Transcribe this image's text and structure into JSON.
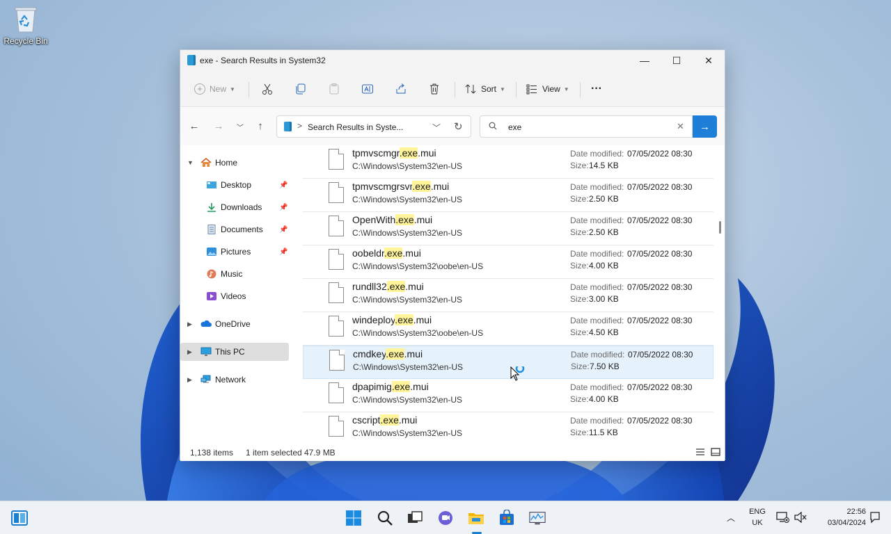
{
  "desktop": {
    "recycle_bin_label": "Recycle Bin"
  },
  "window": {
    "title": "exe - Search Results in System32",
    "controls": {
      "minimize": "—",
      "maximize": "☐",
      "close": "✕"
    }
  },
  "toolbar": {
    "new_label": "New",
    "sort_label": "Sort",
    "view_label": "View",
    "more_label": "···"
  },
  "address": {
    "separator": ">",
    "path": "Search Results in Syste...",
    "search_value": "exe"
  },
  "sidebar": {
    "items": [
      {
        "label": "Home",
        "icon": "home-icon"
      },
      {
        "label": "Desktop",
        "icon": "desktop-icon",
        "pinned": true
      },
      {
        "label": "Downloads",
        "icon": "downloads-icon",
        "pinned": true
      },
      {
        "label": "Documents",
        "icon": "documents-icon",
        "pinned": true
      },
      {
        "label": "Pictures",
        "icon": "pictures-icon",
        "pinned": true
      },
      {
        "label": "Music",
        "icon": "music-icon"
      },
      {
        "label": "Videos",
        "icon": "videos-icon"
      },
      {
        "label": "OneDrive",
        "icon": "onedrive-icon"
      },
      {
        "label": "This PC",
        "icon": "this-pc-icon",
        "selected": true
      },
      {
        "label": "Network",
        "icon": "network-icon"
      }
    ]
  },
  "files": {
    "date_label": "Date modified:",
    "size_label": "Size:",
    "rows": [
      {
        "name_pre": "tpmvscmgr",
        "name_hl": ".exe",
        "name_post": ".mui",
        "path": "C:\\Windows\\System32\\en-US",
        "date": "07/05/2022 08:30",
        "size": "14.5 KB"
      },
      {
        "name_pre": "tpmvscmgrsvr",
        "name_hl": ".exe",
        "name_post": ".mui",
        "path": "C:\\Windows\\System32\\en-US",
        "date": "07/05/2022 08:30",
        "size": "2.50 KB"
      },
      {
        "name_pre": "OpenWith",
        "name_hl": ".exe",
        "name_post": ".mui",
        "path": "C:\\Windows\\System32\\en-US",
        "date": "07/05/2022 08:30",
        "size": "2.50 KB"
      },
      {
        "name_pre": "oobeldr",
        "name_hl": ".exe",
        "name_post": ".mui",
        "path": "C:\\Windows\\System32\\oobe\\en-US",
        "date": "07/05/2022 08:30",
        "size": "4.00 KB"
      },
      {
        "name_pre": "rundll32",
        "name_hl": ".exe",
        "name_post": ".mui",
        "path": "C:\\Windows\\System32\\en-US",
        "date": "07/05/2022 08:30",
        "size": "3.00 KB"
      },
      {
        "name_pre": "windeploy",
        "name_hl": ".exe",
        "name_post": ".mui",
        "path": "C:\\Windows\\System32\\oobe\\en-US",
        "date": "07/05/2022 08:30",
        "size": "4.50 KB"
      },
      {
        "name_pre": "cmdkey",
        "name_hl": ".exe",
        "name_post": ".mui",
        "path": "C:\\Windows\\System32\\en-US",
        "date": "07/05/2022 08:30",
        "size": "7.50 KB",
        "selected": true
      },
      {
        "name_pre": "dpapimig",
        "name_hl": ".exe",
        "name_post": ".mui",
        "path": "C:\\Windows\\System32\\en-US",
        "date": "07/05/2022 08:30",
        "size": "4.00 KB"
      },
      {
        "name_pre": "cscript",
        "name_hl": ".exe",
        "name_post": ".mui",
        "path": "C:\\Windows\\System32\\en-US",
        "date": "07/05/2022 08:30",
        "size": "11.5 KB"
      }
    ]
  },
  "status": {
    "item_count": "1,138 items",
    "selection": "1 item selected",
    "selection_size": "47.9 MB"
  },
  "taskbar": {
    "lang_top": "ENG",
    "lang_bottom": "UK",
    "time": "22:56",
    "date": "03/04/2024"
  },
  "colors": {
    "accent": "#1e7fd8",
    "highlight": "#fff49a",
    "selected_row": "#e5f1fb"
  }
}
